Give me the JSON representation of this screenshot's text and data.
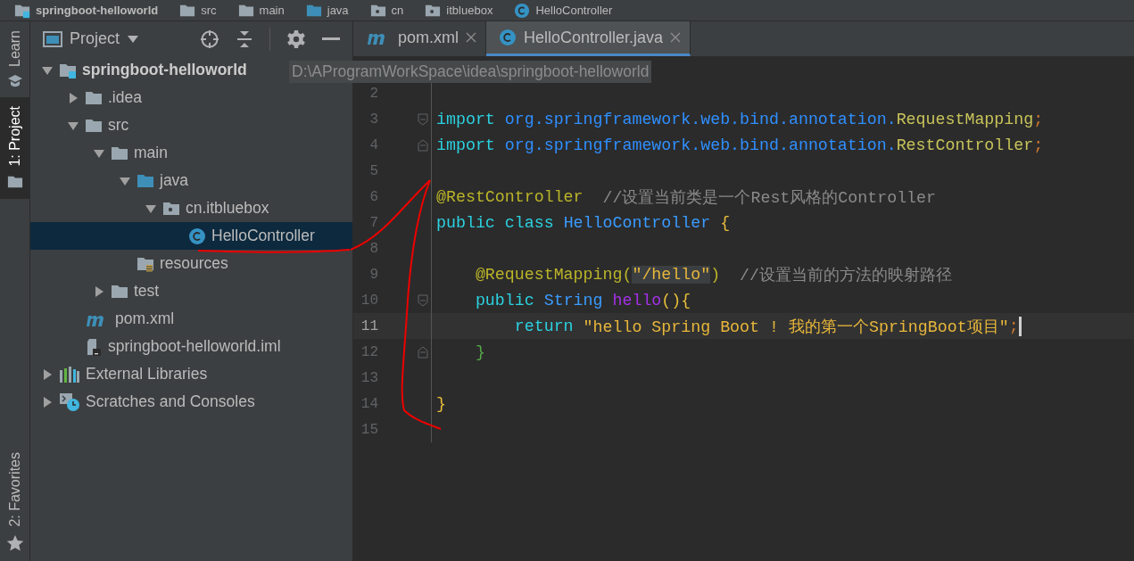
{
  "breadcrumb": [
    {
      "label": "springboot-helloworld",
      "kind": "module"
    },
    {
      "label": "src",
      "kind": "folder"
    },
    {
      "label": "main",
      "kind": "folder"
    },
    {
      "label": "java",
      "kind": "source"
    },
    {
      "label": "cn",
      "kind": "package"
    },
    {
      "label": "itbluebox",
      "kind": "package"
    },
    {
      "label": "HelloController",
      "kind": "class"
    }
  ],
  "side_tabs_top": [
    {
      "label": "Learn",
      "kind": "learn",
      "selected": false
    },
    {
      "label": "1: Project",
      "kind": "folder",
      "selected": true
    }
  ],
  "side_tabs_bottom": [
    {
      "label": "2: Favorites",
      "kind": "star",
      "selected": false
    }
  ],
  "project_panel": {
    "title": "Project",
    "tree": [
      {
        "label": "springboot-helloworld",
        "kind": "module",
        "hint": "D:\\AProgramWorkSpace\\idea\\springboot-helloworld",
        "expanded": true,
        "selected": false,
        "children": [
          {
            "label": ".idea",
            "kind": "folder",
            "expanded": false,
            "selected": false
          },
          {
            "label": "src",
            "kind": "folder",
            "expanded": true,
            "selected": false,
            "children": [
              {
                "label": "main",
                "kind": "folder",
                "expanded": true,
                "selected": false,
                "children": [
                  {
                    "label": "java",
                    "kind": "source",
                    "expanded": true,
                    "selected": false,
                    "children": [
                      {
                        "label": "cn.itbluebox",
                        "kind": "package",
                        "expanded": true,
                        "selected": false,
                        "children": [
                          {
                            "label": "HelloController",
                            "kind": "class",
                            "selected": true
                          }
                        ]
                      }
                    ]
                  },
                  {
                    "label": "resources",
                    "kind": "resources",
                    "selected": false
                  }
                ]
              },
              {
                "label": "test",
                "kind": "folder",
                "expanded": false,
                "selected": false
              }
            ]
          },
          {
            "label": "pom.xml",
            "kind": "maven",
            "selected": false
          },
          {
            "label": "springboot-helloworld.iml",
            "kind": "iml",
            "selected": false
          }
        ]
      },
      {
        "label": "External Libraries",
        "kind": "libraries",
        "expanded": false,
        "selected": false
      },
      {
        "label": "Scratches and Consoles",
        "kind": "scratches",
        "expanded": false,
        "selected": false
      }
    ]
  },
  "editor_tabs": [
    {
      "label": "pom.xml",
      "kind": "maven",
      "selected": false
    },
    {
      "label": "HelloController.java",
      "kind": "class",
      "selected": true
    }
  ],
  "code_lines": [
    {
      "number": "2",
      "kind": "plain",
      "current": false
    },
    {
      "number": "3",
      "kind": "fold-start",
      "current": false,
      "tokens": [
        {
          "text": "import",
          "kind": "keyword"
        },
        {
          "text": " org.springframework.web.bind.annotation.",
          "kind": "package"
        },
        {
          "text": "RequestMapping",
          "kind": "imported"
        },
        {
          "text": ";",
          "kind": "punct"
        }
      ]
    },
    {
      "number": "4",
      "kind": "fold-end",
      "current": false,
      "tokens": [
        {
          "text": "import",
          "kind": "keyword"
        },
        {
          "text": " org.springframework.web.bind.annotation.",
          "kind": "package"
        },
        {
          "text": "RestController",
          "kind": "imported"
        },
        {
          "text": ";",
          "kind": "punct"
        }
      ]
    },
    {
      "number": "5",
      "kind": "plain",
      "current": false
    },
    {
      "number": "6",
      "kind": "plain",
      "current": false,
      "tokens": [
        {
          "text": "@RestController",
          "kind": "annotation"
        },
        {
          "text": "  //设置当前类是一个Rest风格的Controller",
          "kind": "comment"
        }
      ]
    },
    {
      "number": "7",
      "kind": "plain",
      "current": false,
      "tokens": [
        {
          "text": "public class",
          "kind": "keyword"
        },
        {
          "text": " HelloController",
          "kind": "classname"
        },
        {
          "text": " {",
          "kind": "brace"
        }
      ]
    },
    {
      "number": "8",
      "kind": "plain",
      "current": false
    },
    {
      "number": "9",
      "kind": "plain",
      "current": false,
      "tokens": [
        {
          "text": "    @RequestMapping(",
          "kind": "annotation"
        },
        {
          "text": "\"/hello\"",
          "kind": "string-marked"
        },
        {
          "text": ")",
          "kind": "annotation"
        },
        {
          "text": "  //设置当前的方法的映射路径",
          "kind": "comment"
        }
      ]
    },
    {
      "number": "10",
      "kind": "fold-start",
      "current": false,
      "tokens": [
        {
          "text": "    public",
          "kind": "keyword"
        },
        {
          "text": " String",
          "kind": "classname"
        },
        {
          "text": " hello",
          "kind": "method"
        },
        {
          "text": "(){",
          "kind": "brace"
        }
      ]
    },
    {
      "number": "11",
      "kind": "plain",
      "current": true,
      "tokens": [
        {
          "text": "        return",
          "kind": "keyword"
        },
        {
          "text": " \"hello Spring Boot ! 我的第一个SpringBoot项目\"",
          "kind": "string"
        },
        {
          "text": ";",
          "kind": "punct"
        }
      ]
    },
    {
      "number": "12",
      "kind": "fold-end",
      "current": false,
      "tokens": [
        {
          "text": "    }",
          "kind": "brace-close"
        }
      ]
    },
    {
      "number": "13",
      "kind": "plain",
      "current": false
    },
    {
      "number": "14",
      "kind": "plain",
      "current": false,
      "tokens": [
        {
          "text": "}",
          "kind": "brace"
        }
      ]
    },
    {
      "number": "15",
      "kind": "plain",
      "current": false
    }
  ]
}
